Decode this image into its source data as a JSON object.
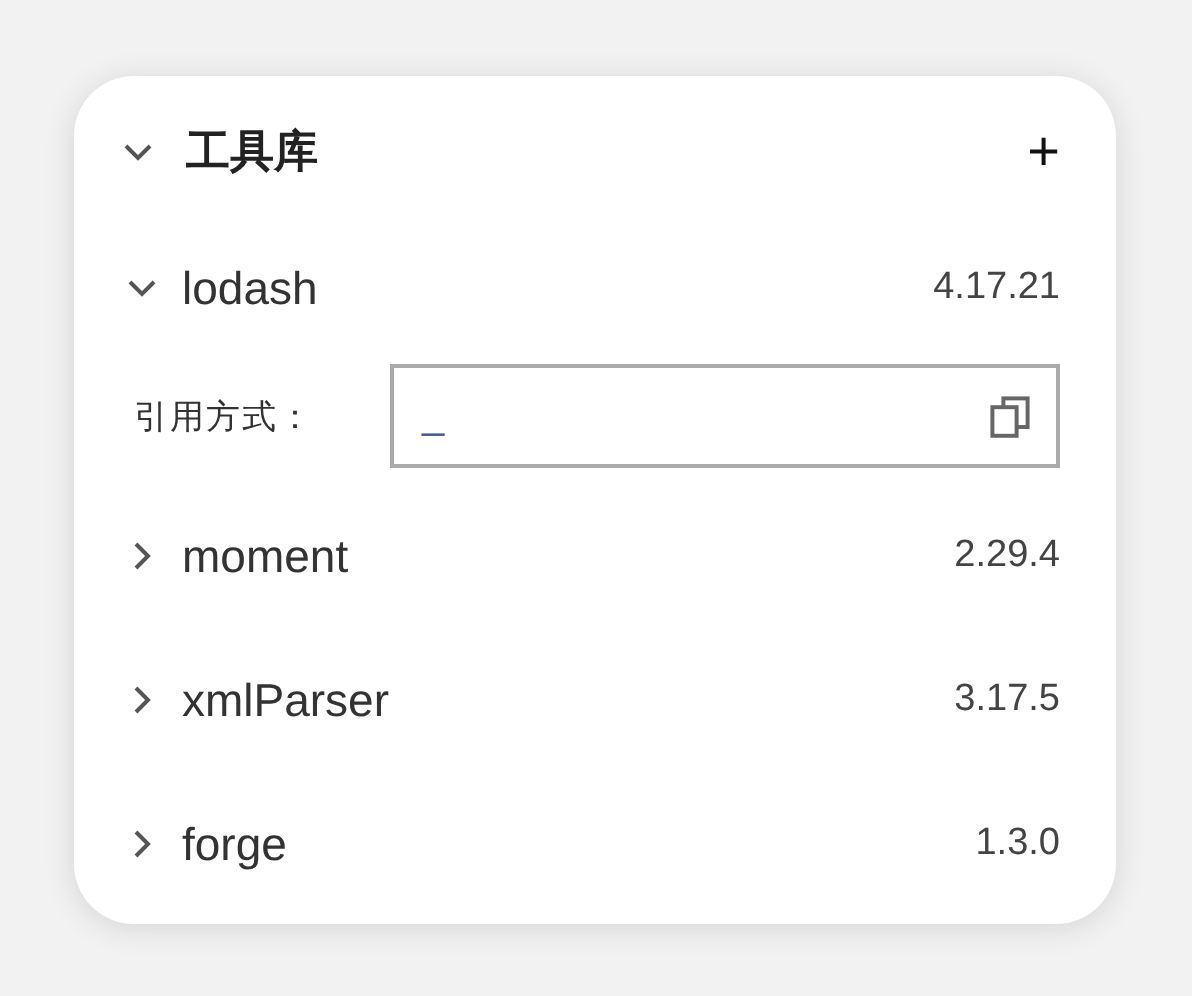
{
  "section": {
    "title": "工具库",
    "expanded": true,
    "add": "+"
  },
  "libraries": [
    {
      "name": "lodash",
      "version": "4.17.21",
      "expanded": true,
      "reference": {
        "label": "引用方式：",
        "value": "_"
      }
    },
    {
      "name": "moment",
      "version": "2.29.4",
      "expanded": false
    },
    {
      "name": "xmlParser",
      "version": "3.17.5",
      "expanded": false
    },
    {
      "name": "forge",
      "version": "1.3.0",
      "expanded": false
    }
  ]
}
